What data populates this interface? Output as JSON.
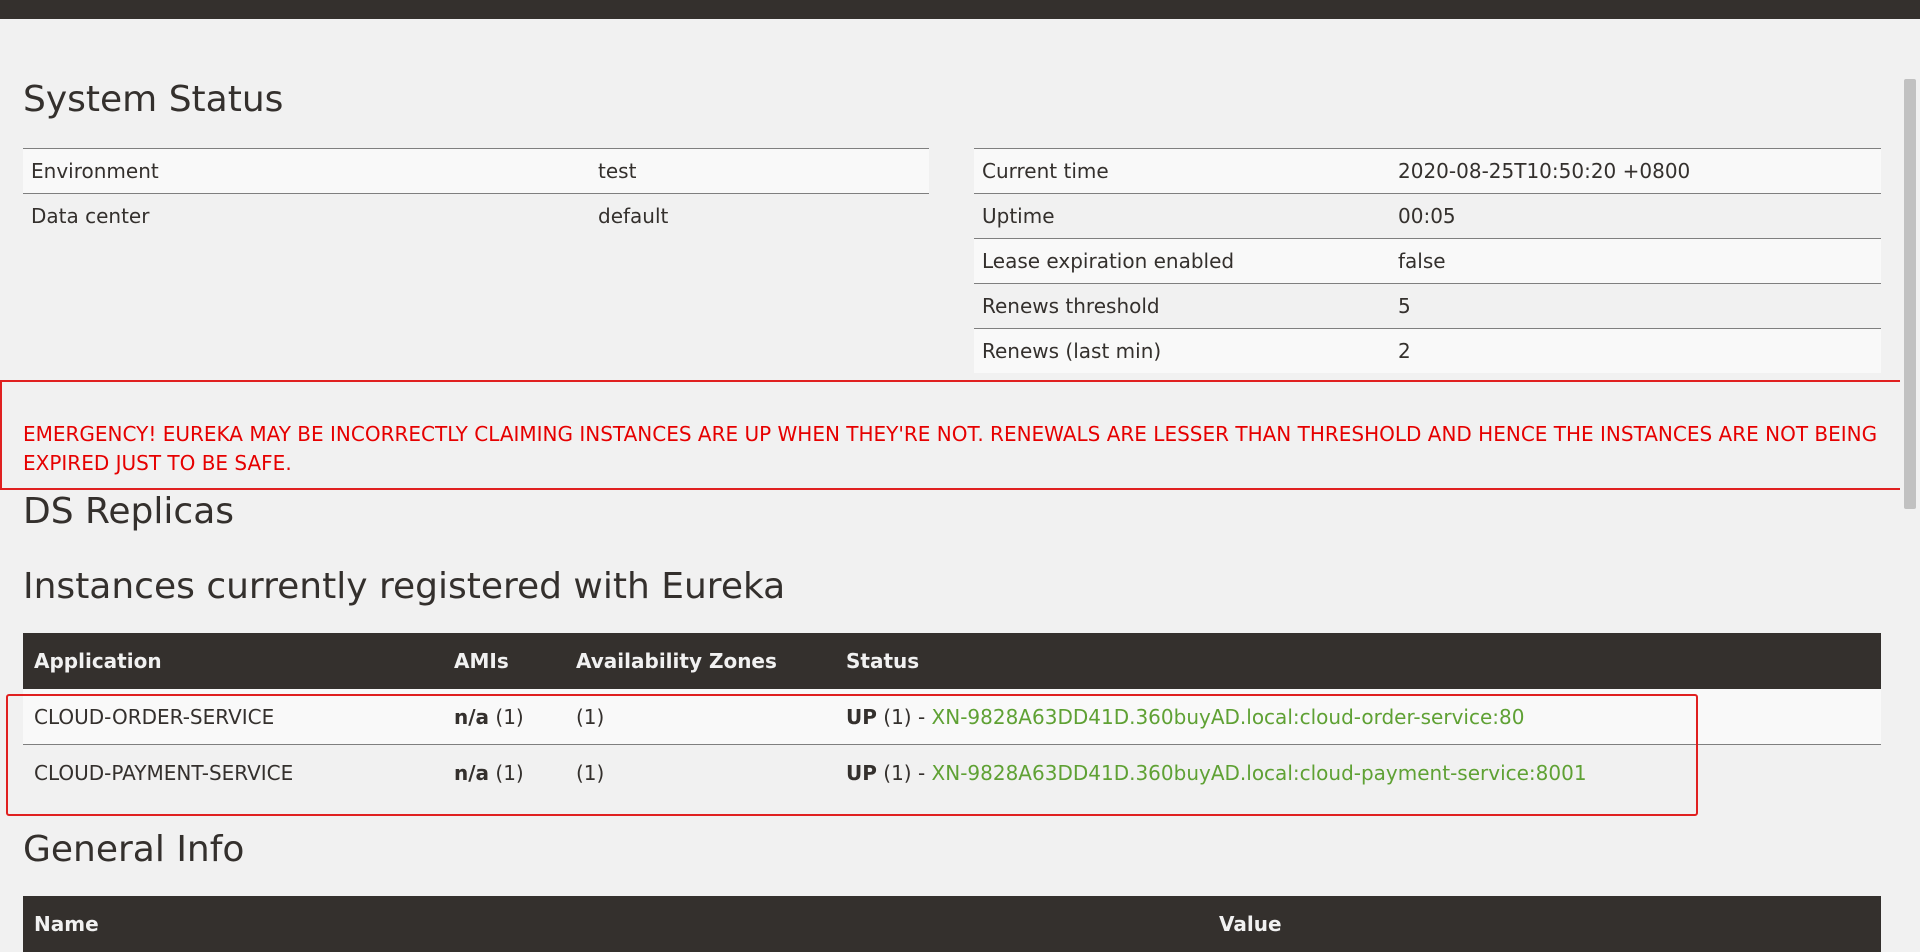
{
  "system_status": {
    "title": "System Status",
    "left": [
      {
        "key": "Environment",
        "value": "test"
      },
      {
        "key": "Data center",
        "value": "default"
      }
    ],
    "right": [
      {
        "key": "Current time",
        "value": "2020-08-25T10:50:20 +0800"
      },
      {
        "key": "Uptime",
        "value": "00:05"
      },
      {
        "key": "Lease expiration enabled",
        "value": "false"
      },
      {
        "key": "Renews threshold",
        "value": "5"
      },
      {
        "key": "Renews (last min)",
        "value": "2"
      }
    ]
  },
  "emergency": "EMERGENCY! EUREKA MAY BE INCORRECTLY CLAIMING INSTANCES ARE UP WHEN THEY'RE NOT. RENEWALS ARE LESSER THAN THRESHOLD AND HENCE THE INSTANCES ARE NOT BEING EXPIRED JUST TO BE SAFE.",
  "ds_replicas": {
    "title": "DS Replicas"
  },
  "instances": {
    "title": "Instances currently registered with Eureka",
    "headers": [
      "Application",
      "AMIs",
      "Availability Zones",
      "Status"
    ],
    "rows": [
      {
        "app": "CLOUD-ORDER-SERVICE",
        "ami_label": "n/a",
        "ami_count": "(1)",
        "zones": "(1)",
        "status_label": "UP",
        "status_count": "(1) - ",
        "instance": "XN-9828A63DD41D.360buyAD.local:cloud-order-service:80"
      },
      {
        "app": "CLOUD-PAYMENT-SERVICE",
        "ami_label": "n/a",
        "ami_count": "(1)",
        "zones": "(1)",
        "status_label": "UP",
        "status_count": "(1) - ",
        "instance": "XN-9828A63DD41D.360buyAD.local:cloud-payment-service:8001"
      }
    ]
  },
  "general_info": {
    "title": "General Info",
    "headers": [
      "Name",
      "Value"
    ]
  }
}
